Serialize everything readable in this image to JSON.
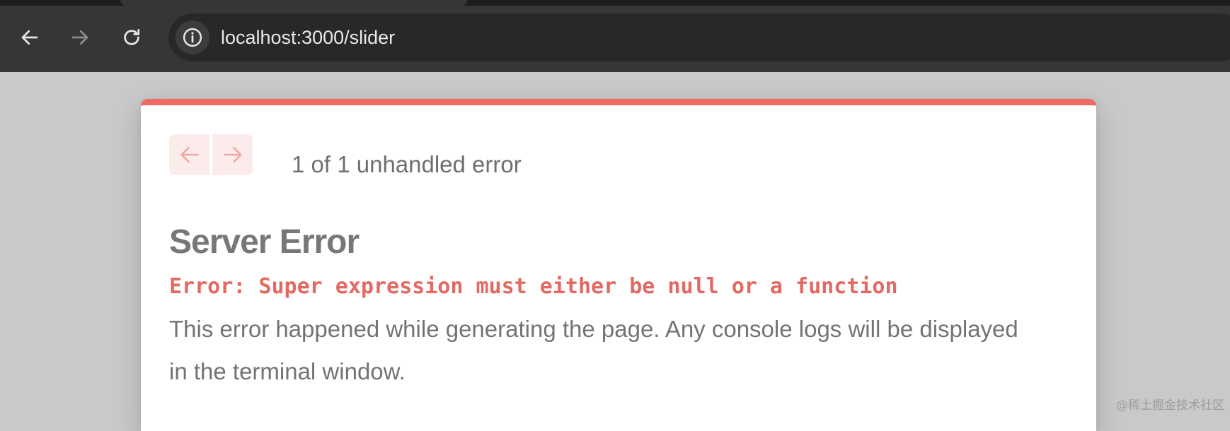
{
  "browser": {
    "url": "localhost:3000/slider",
    "icons": {
      "back": "arrow-left-icon",
      "forward": "arrow-right-icon",
      "reload": "reload-icon",
      "site_info": "info-icon"
    }
  },
  "error_overlay": {
    "count_text": "1 of 1 unhandled error",
    "title": "Server Error",
    "message": "Error: Super expression must either be null or a function",
    "description": "This error happened while generating the page. Any console logs will be displayed in the terminal window.",
    "pager_icons": {
      "previous": "arrow-left-icon",
      "next": "arrow-right-icon"
    }
  },
  "watermark": "@稀土掘金技术社区",
  "colors": {
    "chrome_bg": "#363636",
    "omnibox_bg": "#282828",
    "page_bg": "#c9c9c9",
    "card_accent": "#ef6a62",
    "error_red": "#e26a63",
    "pager_bg": "#fcebeb",
    "pager_arrow": "#efa9a4",
    "text_gray": "#737373"
  }
}
